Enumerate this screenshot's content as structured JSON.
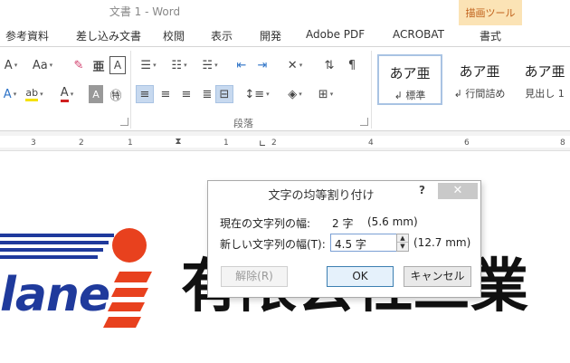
{
  "titlebar": {
    "title": "文書 1 - Word",
    "context_tab": "描画ツール"
  },
  "tabs": [
    {
      "label": "参考資料"
    },
    {
      "label": "差し込み文書"
    },
    {
      "label": "校閲"
    },
    {
      "label": "表示"
    },
    {
      "label": "開発"
    },
    {
      "label": "Adobe  PDF"
    },
    {
      "label": "ACROBAT"
    },
    {
      "label": "書式"
    }
  ],
  "ribbon": {
    "font_group": {
      "aa_label": "Aa"
    },
    "paragraph_group": {
      "label": "段落"
    },
    "styles": [
      {
        "sample": "あア亜",
        "name": "標準"
      },
      {
        "sample": "あア亜",
        "name": "行間詰め"
      },
      {
        "sample": "あア亜",
        "name": "見出し 1"
      }
    ]
  },
  "ruler": {
    "numbers": [
      "3",
      "2",
      "1",
      "1",
      "2",
      "4",
      "6",
      "8"
    ]
  },
  "document": {
    "logo_wordmark": "lane",
    "company_text": "有限会社三業"
  },
  "dialog": {
    "title": "文字の均等割り付け",
    "help": "?",
    "close": "✕",
    "current_label": "現在の文字列の幅:",
    "current_value": "2 字",
    "current_mm": "(5.6 mm)",
    "new_label": "新しい文字列の幅(T):",
    "new_value": "4.5 字",
    "new_mm": "(12.7 mm)",
    "buttons": {
      "remove": "解除(R)",
      "ok": "OK",
      "cancel": "キャンセル"
    }
  },
  "colors": {
    "accent_blue": "#1f3a9c",
    "accent_orange": "#e8411e",
    "context_tab_bg": "#fbe3b5"
  }
}
